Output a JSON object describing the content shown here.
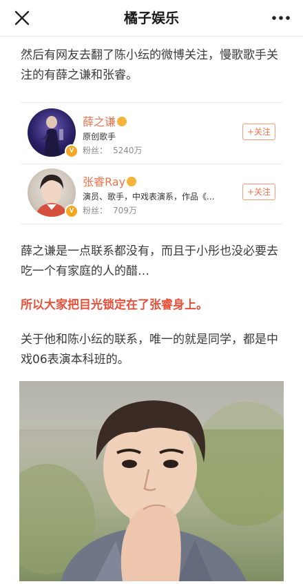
{
  "header": {
    "title": "橘子娱乐",
    "close_icon": "close-icon",
    "more_icon": "more-dots-icon"
  },
  "article": {
    "para1": "然后有网友去翻了陈小纭的微博关注，慢歌歌手关注的有薛之谦和张睿。",
    "para2": "薛之谦是一点联系都没有，而且于小彤也没必要去吃一个有家庭的人的醋…",
    "para3": "所以大家把目光锁定在了张睿身上。",
    "para4": "关于他和陈小纭的联系，唯一的就是同学，都是中戏06表演本科班的。"
  },
  "users": [
    {
      "name": "薛之谦",
      "desc": "原创歌手",
      "fans_label": "粉丝：",
      "fans_count": "5240万",
      "follow_label": "+关注",
      "badge": "V"
    },
    {
      "name": "张睿Ray",
      "desc": "演员、歌手，中戏表演系，作品《...",
      "fans_label": "粉丝：",
      "fans_count": "709万",
      "follow_label": "+关注",
      "badge": "V"
    }
  ],
  "colors": {
    "accent": "#eb7350",
    "highlight_text": "#e8503a",
    "verified_badge": "#f5a623"
  }
}
